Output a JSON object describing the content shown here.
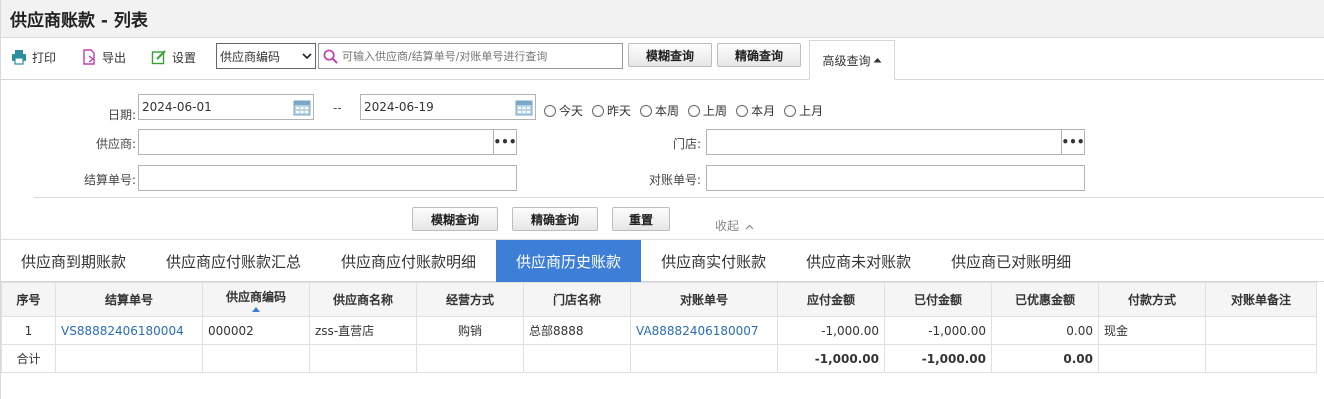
{
  "title": "供应商账款 - 列表",
  "toolbar": {
    "print_label": "打印",
    "export_label": "导出",
    "settings_label": "设置",
    "search_field_selected": "供应商编码",
    "search_placeholder": "可输入供应商/结算单号/对账单号进行查询",
    "fuzzy_label": "模糊查询",
    "exact_label": "精确查询",
    "advanced_label": "高级查询"
  },
  "filter": {
    "date_label": "日期:",
    "date_from": "2024-06-01",
    "date_sep": "--",
    "date_to": "2024-06-19",
    "quick_ranges": [
      "今天",
      "昨天",
      "本周",
      "上周",
      "本月",
      "上月"
    ],
    "supplier_label": "供应商:",
    "supplier_value": "",
    "store_label": "门店:",
    "store_value": "",
    "settlement_label": "结算单号:",
    "settlement_value": "",
    "recon_label": "对账单号:",
    "recon_value": "",
    "fuzzy_label": "模糊查询",
    "exact_label": "精确查询",
    "reset_label": "重置",
    "collapse_label": "收起"
  },
  "tabs": [
    {
      "label": "供应商到期账款"
    },
    {
      "label": "供应商应付账款汇总"
    },
    {
      "label": "供应商应付账款明细"
    },
    {
      "label": "供应商历史账款"
    },
    {
      "label": "供应商实付账款"
    },
    {
      "label": "供应商未对账款"
    },
    {
      "label": "供应商已对账明细"
    }
  ],
  "active_tab": 3,
  "table": {
    "columns": [
      "序号",
      "结算单号",
      "供应商编码",
      "供应商名称",
      "经营方式",
      "门店名称",
      "对账单号",
      "应付金额",
      "已付金额",
      "已优惠金额",
      "付款方式",
      "对账单备注"
    ],
    "rows": [
      [
        "1",
        "VS88882406180004",
        "000002",
        "zss-直营店",
        "购销",
        "总部8888",
        "VA88882406180007",
        "-1,000.00",
        "-1,000.00",
        "0.00",
        "现金",
        ""
      ]
    ],
    "summary": [
      "合计",
      "",
      "",
      "",
      "",
      "",
      "",
      "-1,000.00",
      "-1,000.00",
      "0.00",
      "",
      ""
    ]
  },
  "colors": {
    "accent": "#3d7fd6",
    "link": "#2a6db5"
  }
}
